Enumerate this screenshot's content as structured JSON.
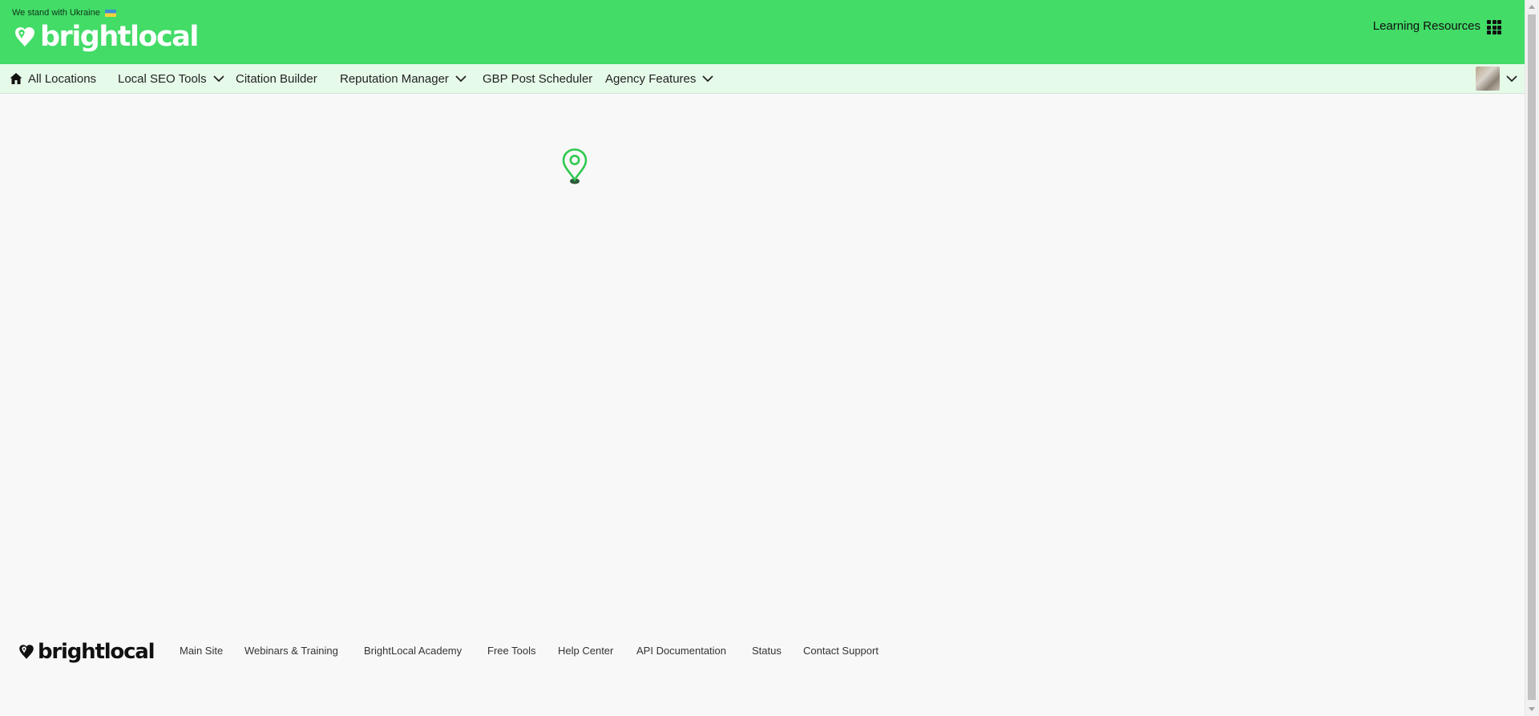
{
  "header": {
    "banner_text": "We stand with Ukraine",
    "logo_text": "brightlocal",
    "learning_resources": "Learning Resources",
    "apps_icon": "grid-icon"
  },
  "nav": {
    "home_label": "All Locations",
    "items": [
      {
        "label": "Local SEO Tools",
        "has_dropdown": true
      },
      {
        "label": "Citation Builder",
        "has_dropdown": false
      },
      {
        "label": "Reputation Manager",
        "has_dropdown": true
      },
      {
        "label": "GBP Post Scheduler",
        "has_dropdown": false
      },
      {
        "label": "Agency Features",
        "has_dropdown": true
      }
    ]
  },
  "main": {
    "loading_icon": "map-pin-icon"
  },
  "footer": {
    "logo_text": "brightlocal",
    "links": [
      "Main Site",
      "Webinars & Training",
      "BrightLocal Academy",
      "Free Tools",
      "Help Center",
      "API Documentation",
      "Status",
      "Contact Support"
    ]
  },
  "colors": {
    "brand_green": "#42dc67",
    "nav_bg": "#e6fae9",
    "page_bg": "#f8f8f8",
    "pin_green": "#2ec94f"
  }
}
